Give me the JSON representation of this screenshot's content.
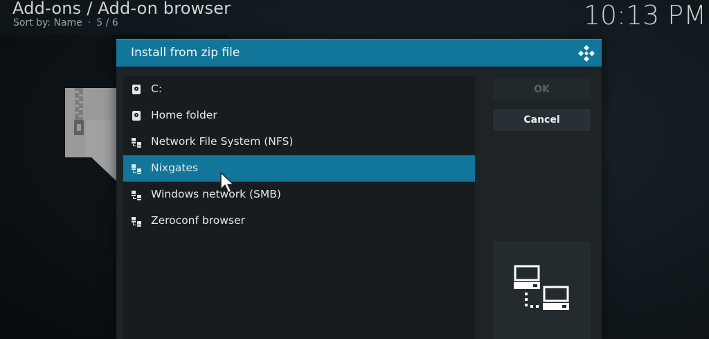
{
  "header": {
    "title": "Add-ons / Add-on browser",
    "sort_label": "Sort by: Name",
    "separator": "·",
    "position": "5 / 6",
    "clock": "10:13 PM"
  },
  "dialog": {
    "title": "Install from zip file",
    "items": [
      {
        "label": "C:",
        "icon": "drive-icon"
      },
      {
        "label": "Home folder",
        "icon": "drive-icon"
      },
      {
        "label": "Network File System (NFS)",
        "icon": "network-icon"
      },
      {
        "label": "Nixgates",
        "icon": "network-icon",
        "selected": true
      },
      {
        "label": "Windows network (SMB)",
        "icon": "network-icon"
      },
      {
        "label": "Zeroconf browser",
        "icon": "network-icon"
      }
    ],
    "ok_label": "OK",
    "cancel_label": "Cancel"
  },
  "colors": {
    "accent": "#12769a",
    "dialog_bg": "#1d2327",
    "list_bg": "#171c1f"
  }
}
